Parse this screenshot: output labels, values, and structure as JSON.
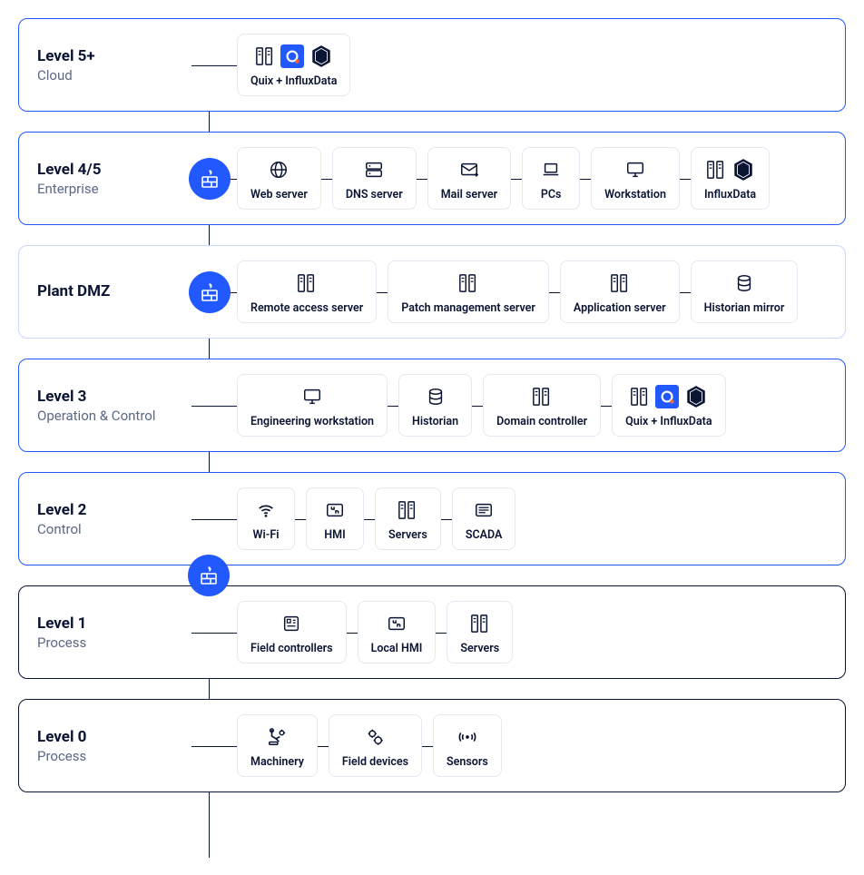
{
  "levels": [
    {
      "id": "level5plus",
      "title": "Level 5+",
      "subtitle": "Cloud",
      "border": "blue",
      "firewall": false,
      "nodes": [
        {
          "name": "quix-influxdata-node",
          "label": "Quix + InfluxData",
          "icons": [
            "rack-icon",
            "quix-icon",
            "influx-icon"
          ]
        }
      ]
    },
    {
      "id": "level45",
      "title": "Level 4/5",
      "subtitle": "Enterprise",
      "border": "blue",
      "firewall": true,
      "nodes": [
        {
          "name": "web-server-node",
          "label": "Web server",
          "icons": [
            "globe-icon"
          ]
        },
        {
          "name": "dns-server-node",
          "label": "DNS server",
          "icons": [
            "dns-icon"
          ]
        },
        {
          "name": "mail-server-node",
          "label": "Mail server",
          "icons": [
            "mail-icon"
          ]
        },
        {
          "name": "pcs-node",
          "label": "PCs",
          "icons": [
            "laptop-icon"
          ]
        },
        {
          "name": "workstation-node",
          "label": "Workstation",
          "icons": [
            "monitor-icon"
          ]
        },
        {
          "name": "influxdata-node",
          "label": "InfluxData",
          "icons": [
            "rack-icon",
            "influx-icon"
          ]
        }
      ]
    },
    {
      "id": "plantdmz",
      "title": "Plant DMZ",
      "subtitle": "",
      "border": "lightblue",
      "firewall": true,
      "nodes": [
        {
          "name": "remote-access-node",
          "label": "Remote access server",
          "icons": [
            "rack-icon"
          ]
        },
        {
          "name": "patch-mgmt-node",
          "label": "Patch management server",
          "icons": [
            "rack-icon"
          ]
        },
        {
          "name": "application-server-node",
          "label": "Application server",
          "icons": [
            "rack-icon"
          ]
        },
        {
          "name": "historian-mirror-node",
          "label": "Historian mirror",
          "icons": [
            "db-icon"
          ]
        }
      ]
    },
    {
      "id": "level3",
      "title": "Level 3",
      "subtitle": "Operation & Control",
      "border": "blue",
      "firewall": false,
      "nodes": [
        {
          "name": "eng-workstation-node",
          "label": "Engineering workstation",
          "icons": [
            "monitor-icon"
          ]
        },
        {
          "name": "historian-node",
          "label": "Historian",
          "icons": [
            "db-icon"
          ]
        },
        {
          "name": "domain-controller-node",
          "label": "Domain controller",
          "icons": [
            "rack-icon"
          ]
        },
        {
          "name": "quix-influxdata-node-2",
          "label": "Quix + InfluxData",
          "icons": [
            "rack-icon",
            "quix-icon",
            "influx-icon"
          ]
        }
      ]
    },
    {
      "id": "level2",
      "title": "Level 2",
      "subtitle": "Control",
      "border": "blue",
      "firewall": false,
      "nodes": [
        {
          "name": "wifi-node",
          "label": "Wi-Fi",
          "icons": [
            "wifi-icon"
          ]
        },
        {
          "name": "hmi-node",
          "label": "HMI",
          "icons": [
            "hmi-icon"
          ]
        },
        {
          "name": "servers-node",
          "label": "Servers",
          "icons": [
            "rack-icon"
          ]
        },
        {
          "name": "scada-node",
          "label": "SCADA",
          "icons": [
            "scada-icon"
          ]
        }
      ]
    },
    {
      "id": "level1",
      "title": "Level 1",
      "subtitle": "Process",
      "border": "black",
      "firewall": false,
      "nodes": [
        {
          "name": "field-controllers-node",
          "label": "Field controllers",
          "icons": [
            "controller-icon"
          ]
        },
        {
          "name": "local-hmi-node",
          "label": "Local HMI",
          "icons": [
            "hmi-icon"
          ]
        },
        {
          "name": "servers-node-2",
          "label": "Servers",
          "icons": [
            "rack-icon"
          ]
        }
      ]
    },
    {
      "id": "level0",
      "title": "Level 0",
      "subtitle": "Process",
      "border": "black",
      "firewall": false,
      "nodes": [
        {
          "name": "machinery-node",
          "label": "Machinery",
          "icons": [
            "robot-icon"
          ]
        },
        {
          "name": "field-devices-node",
          "label": "Field devices",
          "icons": [
            "gear-icon"
          ]
        },
        {
          "name": "sensors-node",
          "label": "Sensors",
          "icons": [
            "sensor-icon"
          ]
        }
      ]
    }
  ],
  "between_firewall_after_index": 4
}
